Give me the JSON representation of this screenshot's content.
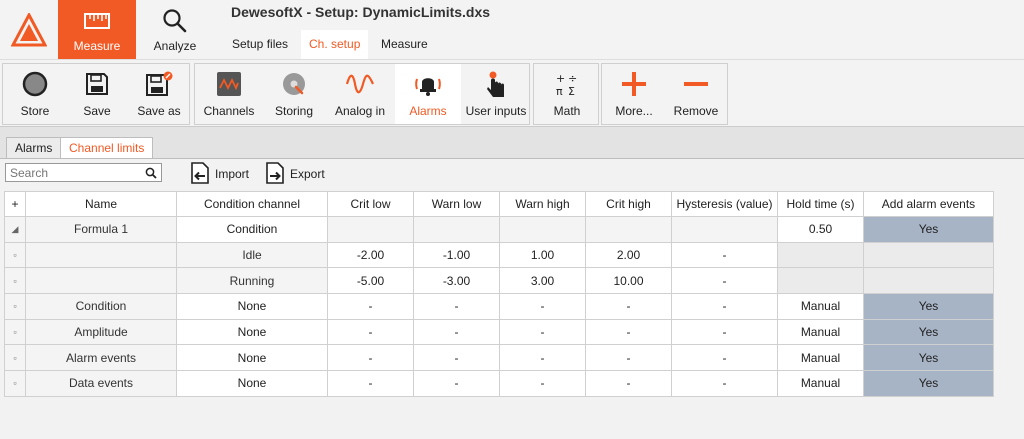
{
  "app": {
    "title": "DewesoftX - Setup: DynamicLimits.dxs"
  },
  "colors": {
    "accent": "#f15a24",
    "highlight": "#a7b4c6"
  },
  "modes": [
    {
      "label": "Measure",
      "icon": "measure-icon"
    },
    {
      "label": "Analyze",
      "icon": "magnifier-icon"
    }
  ],
  "subtabs": [
    {
      "label": "Setup files"
    },
    {
      "label": "Ch. setup"
    },
    {
      "label": "Measure"
    }
  ],
  "toolbar": {
    "store": "Store",
    "save": "Save",
    "save_as": "Save as",
    "channels": "Channels",
    "storing": "Storing",
    "analog_in": "Analog in",
    "alarms": "Alarms",
    "user_inputs": "User inputs",
    "math": "Math",
    "more": "More...",
    "remove": "Remove"
  },
  "content_tabs": [
    {
      "label": "Alarms"
    },
    {
      "label": "Channel limits"
    }
  ],
  "search": {
    "placeholder": "Search"
  },
  "actions": {
    "import": "Import",
    "export": "Export"
  },
  "table": {
    "add_col": "+",
    "headers": [
      "Name",
      "Condition channel",
      "Crit low",
      "Warn low",
      "Warn high",
      "Crit high",
      "Hysteresis (value)",
      "Hold time (s)",
      "Add alarm events"
    ],
    "group": {
      "expander": "◢",
      "name": "Formula 1",
      "condition_channel": "Condition",
      "hold_time": "0.50",
      "add_alarm_events": "Yes"
    },
    "sub_rows": [
      {
        "marker": "▫",
        "condition": "Idle",
        "crit_low": "-2.00",
        "warn_low": "-1.00",
        "warn_high": "1.00",
        "crit_high": "2.00",
        "hysteresis": "-"
      },
      {
        "marker": "▫",
        "condition": "Running",
        "crit_low": "-5.00",
        "warn_low": "-3.00",
        "warn_high": "3.00",
        "crit_high": "10.00",
        "hysteresis": "-"
      }
    ],
    "rows": [
      {
        "marker": "▫",
        "name": "Condition",
        "condition_channel": "None",
        "crit_low": "-",
        "warn_low": "-",
        "warn_high": "-",
        "crit_high": "-",
        "hysteresis": "-",
        "hold_time": "Manual",
        "add_alarm_events": "Yes"
      },
      {
        "marker": "▫",
        "name": "Amplitude",
        "condition_channel": "None",
        "crit_low": "-",
        "warn_low": "-",
        "warn_high": "-",
        "crit_high": "-",
        "hysteresis": "-",
        "hold_time": "Manual",
        "add_alarm_events": "Yes"
      },
      {
        "marker": "▫",
        "name": "Alarm events",
        "condition_channel": "None",
        "crit_low": "-",
        "warn_low": "-",
        "warn_high": "-",
        "crit_high": "-",
        "hysteresis": "-",
        "hold_time": "Manual",
        "add_alarm_events": "Yes"
      },
      {
        "marker": "▫",
        "name": "Data events",
        "condition_channel": "None",
        "crit_low": "-",
        "warn_low": "-",
        "warn_high": "-",
        "crit_high": "-",
        "hysteresis": "-",
        "hold_time": "Manual",
        "add_alarm_events": "Yes"
      }
    ]
  }
}
